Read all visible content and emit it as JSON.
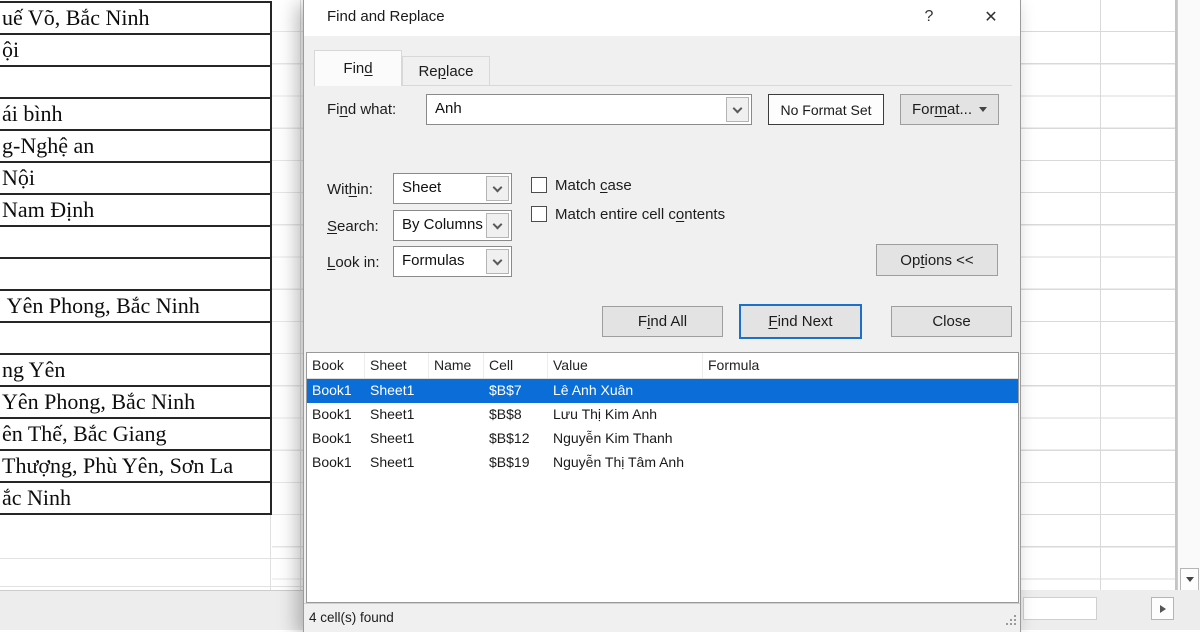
{
  "colors": {
    "selection_blue": "#0b6dd7",
    "default_button_border": "#1d70c8",
    "dialog_bg": "#f0f0f0",
    "titlebar_bg": "#ffffff",
    "button_bg": "#e3e3e3"
  },
  "dialog": {
    "title": "Find and Replace",
    "help_glyph": "?",
    "close_glyph": "✕",
    "tabs": {
      "find": {
        "pre": "Fin",
        "key": "d",
        "post": ""
      },
      "replace": {
        "pre": "Re",
        "key": "p",
        "post": "lace"
      }
    },
    "fields": {
      "find_what": {
        "label": {
          "pre": "Fi",
          "key": "n",
          "post": "d what:"
        },
        "value": "Anh"
      },
      "within": {
        "label": {
          "pre": "Wit",
          "key": "h",
          "post": "in:"
        },
        "value": "Sheet"
      },
      "search": {
        "label": {
          "pre": "",
          "key": "S",
          "post": "earch:"
        },
        "value": "By Columns"
      },
      "look_in": {
        "label": {
          "pre": "",
          "key": "L",
          "post": "ook in:"
        },
        "value": "Formulas"
      }
    },
    "format_preview": "No Format Set",
    "checkboxes": {
      "match_case": {
        "pre": "Match ",
        "key": "c",
        "post": "ase",
        "checked": false
      },
      "match_entire": {
        "pre": "Match entire cell c",
        "key": "o",
        "post": "ntents",
        "checked": false
      }
    },
    "buttons": {
      "format": {
        "pre": "For",
        "key": "m",
        "post": "at..."
      },
      "options": {
        "pre": "Op",
        "key": "t",
        "post": "ions <<"
      },
      "find_all": {
        "pre": "F",
        "key": "i",
        "post": "nd All"
      },
      "find_next": {
        "pre": "",
        "key": "F",
        "post": "ind Next"
      },
      "close": {
        "pre": "",
        "key": "",
        "post": "Close"
      }
    },
    "results": {
      "columns": [
        "Book",
        "Sheet",
        "Name",
        "Cell",
        "Value",
        "Formula"
      ],
      "rows": [
        {
          "book": "Book1",
          "sheet": "Sheet1",
          "name": "",
          "cell": "$B$7",
          "value": "Lê Anh Xuân",
          "formula": "",
          "selected": true
        },
        {
          "book": "Book1",
          "sheet": "Sheet1",
          "name": "",
          "cell": "$B$8",
          "value": "Lưu Thị Kim Anh",
          "formula": "",
          "selected": false
        },
        {
          "book": "Book1",
          "sheet": "Sheet1",
          "name": "",
          "cell": "$B$12",
          "value": "Nguyễn Kim Thanh",
          "formula": "",
          "selected": false
        },
        {
          "book": "Book1",
          "sheet": "Sheet1",
          "name": "",
          "cell": "$B$19",
          "value": "Nguyễn Thị Tâm Anh",
          "formula": "",
          "selected": false
        }
      ],
      "status": "4 cell(s) found"
    }
  },
  "spreadsheet": {
    "rows": [
      "uế Võ, Bắc Ninh",
      "ội",
      "",
      "ái bình",
      "g-Nghệ an",
      "Nội",
      "Nam Định",
      "",
      "",
      " Yên Phong, Bắc Ninh",
      "",
      "ng Yên",
      "Yên Phong, Bắc Ninh",
      "ên Thế, Bắc Giang",
      "Thượng, Phù Yên, Sơn La",
      "ắc Ninh"
    ]
  }
}
